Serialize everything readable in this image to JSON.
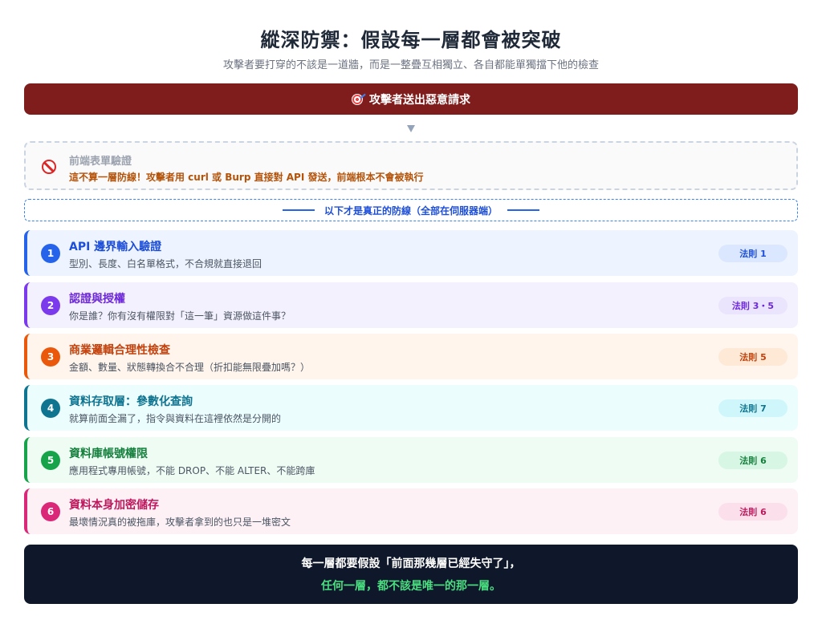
{
  "header": {
    "title": "縱深防禦：假設每一層都會被突破",
    "subtitle": "攻擊者要打穿的不該是一道牆，而是一整疊互相獨立、各自都能單獨擋下他的檢查"
  },
  "attacker": {
    "icon": "dart-target-icon",
    "label": "攻擊者送出惡意請求"
  },
  "frontend": {
    "icon": "prohibited-icon",
    "title": "前端表單驗證",
    "desc": "這不算一層防線！攻擊者用 curl 或 Burp 直接對 API 發送，前端根本不會被執行"
  },
  "divider": {
    "text": "以下才是真正的防線（全部在伺服器端）"
  },
  "layers": [
    {
      "num": "1",
      "title": "API 邊界輸入驗證",
      "desc": "型別、長度、白名單格式，不合規就直接退回",
      "badge": "法則 1"
    },
    {
      "num": "2",
      "title": "認證與授權",
      "desc": "你是誰？你有沒有權限對「這一筆」資源做這件事？",
      "badge": "法則 3・5"
    },
    {
      "num": "3",
      "title": "商業邏輯合理性檢查",
      "desc": "金額、數量、狀態轉換合不合理（折扣能無限疊加嗎？）",
      "badge": "法則 5"
    },
    {
      "num": "4",
      "title": "資料存取層：參數化查詢",
      "desc": "就算前面全漏了，指令與資料在這裡依然是分開的",
      "badge": "法則 7"
    },
    {
      "num": "5",
      "title": "資料庫帳號權限",
      "desc": "應用程式專用帳號，不能 DROP、不能 ALTER、不能跨庫",
      "badge": "法則 6"
    },
    {
      "num": "6",
      "title": "資料本身加密儲存",
      "desc": "最壞情況真的被拖庫，攻擊者拿到的也只是一堆密文",
      "badge": "法則 6"
    }
  ],
  "footer": {
    "line1": "每一層都要假設「前面那幾層已經失守了」，",
    "line2": "任何一層，都不該是唯一的那一層。"
  }
}
